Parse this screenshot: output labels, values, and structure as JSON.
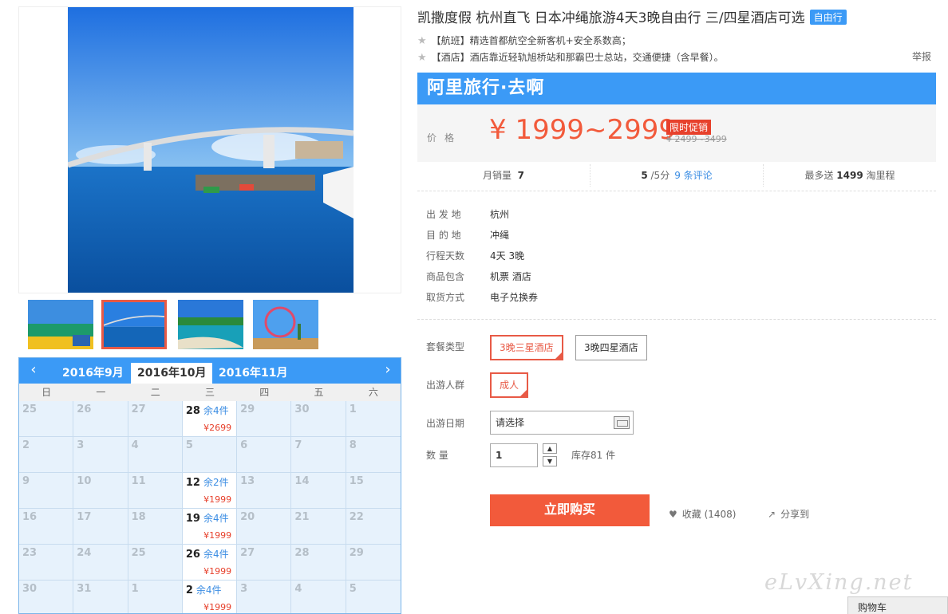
{
  "title": "凯撒度假 杭州直飞 日本冲绳旅游4天3晚自由行 三/四星酒店可选",
  "tag": "自由行",
  "features": [
    "【航班】精选首都航空全新客机+安全系数高；",
    "【酒店】酒店靠近轻轨旭桥站和那霸巴士总站，交通便捷（含早餐）。"
  ],
  "report": "举报",
  "promo": {
    "brand": "阿里旅行·去啊",
    "price_label": "价格",
    "price": "¥ 1999~2999",
    "promo_tag": "限时促销",
    "old_price": "¥ 2499~3499"
  },
  "stats": {
    "sales_label": "月销量",
    "sales": "7",
    "rating": "5",
    "rating_unit": "/5分",
    "reviews": "9 条评论",
    "points_prefix": "最多送",
    "points": "1499",
    "points_unit": "淘里程"
  },
  "info": [
    {
      "label": "出 发 地",
      "value": "杭州"
    },
    {
      "label": "目 的 地",
      "value": "冲绳"
    },
    {
      "label": "行程天数",
      "value": "4天 3晚"
    },
    {
      "label": "商品包含",
      "value": "机票   酒店"
    },
    {
      "label": "取货方式",
      "value": "电子兑换券"
    }
  ],
  "options": {
    "package_label": "套餐类型",
    "packages": [
      "3晚三星酒店",
      "3晚四星酒店"
    ],
    "crowd_label": "出游人群",
    "crowd": "成人",
    "date_label": "出游日期",
    "date_placeholder": "请选择",
    "qty_label": "数   量",
    "qty": "1",
    "stock": "库存81 件"
  },
  "buy": "立即购买",
  "fav": "收藏 (1408)",
  "share": "分享到",
  "watermark": "eLvXing.net",
  "cart": "购物车",
  "calendar": {
    "months": [
      "2016年9月",
      "2016年10月",
      "2016年11月"
    ],
    "weekdays": [
      "日",
      "一",
      "二",
      "三",
      "四",
      "五",
      "六"
    ],
    "rows": [
      [
        {
          "d": "25"
        },
        {
          "d": "26"
        },
        {
          "d": "27"
        },
        {
          "d": "28",
          "s": "余4件",
          "p": "¥2699"
        },
        {
          "d": "29"
        },
        {
          "d": "30"
        },
        {
          "d": "1"
        }
      ],
      [
        {
          "d": "2"
        },
        {
          "d": "3"
        },
        {
          "d": "4"
        },
        {
          "d": "5"
        },
        {
          "d": "6"
        },
        {
          "d": "7"
        },
        {
          "d": "8"
        }
      ],
      [
        {
          "d": "9"
        },
        {
          "d": "10"
        },
        {
          "d": "11"
        },
        {
          "d": "12",
          "s": "余2件",
          "p": "¥1999"
        },
        {
          "d": "13"
        },
        {
          "d": "14"
        },
        {
          "d": "15"
        }
      ],
      [
        {
          "d": "16"
        },
        {
          "d": "17"
        },
        {
          "d": "18"
        },
        {
          "d": "19",
          "s": "余4件",
          "p": "¥1999"
        },
        {
          "d": "20"
        },
        {
          "d": "21"
        },
        {
          "d": "22"
        }
      ],
      [
        {
          "d": "23"
        },
        {
          "d": "24"
        },
        {
          "d": "25"
        },
        {
          "d": "26",
          "s": "余4件",
          "p": "¥1999"
        },
        {
          "d": "27"
        },
        {
          "d": "28"
        },
        {
          "d": "29"
        }
      ],
      [
        {
          "d": "30"
        },
        {
          "d": "31"
        },
        {
          "d": "1"
        },
        {
          "d": "2",
          "s": "余4件",
          "p": "¥1999"
        },
        {
          "d": "3"
        },
        {
          "d": "4"
        },
        {
          "d": "5"
        }
      ]
    ]
  },
  "colors": {
    "accent": "#3b9af6",
    "price": "#f25a3b",
    "selected": "#e85a46"
  }
}
